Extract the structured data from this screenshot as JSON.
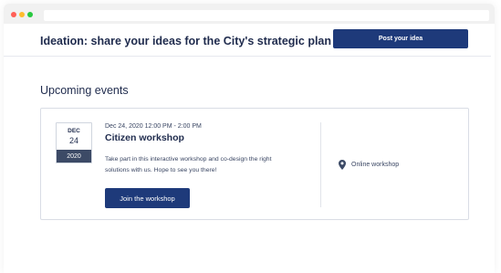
{
  "header": {
    "title": "Ideation: share your ideas for the City's strategic plan",
    "post_button_label": "Post your idea"
  },
  "events": {
    "section_title": "Upcoming events",
    "items": [
      {
        "badge_month": "DEC",
        "badge_day": "24",
        "badge_year": "2020",
        "datetime": "Dec 24, 2020 12:00 PM - 2:00 PM",
        "name": "Citizen workshop",
        "description": "Take part in this interactive workshop and co-design the right solutions with us. Hope to see you there!",
        "join_label": "Join the workshop",
        "location": "Online workshop",
        "location_icon": "map-pin-icon"
      }
    ]
  },
  "colors": {
    "primary": "#1e3a7a",
    "text": "#1f2b4d",
    "badge_year_bg": "#3c4a66"
  }
}
